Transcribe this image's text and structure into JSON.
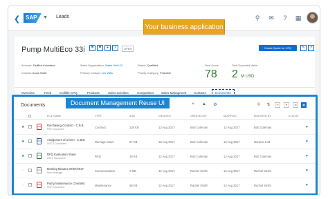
{
  "shell": {
    "back_icon": "back-icon",
    "logo_text": "SAP",
    "title": "Leads",
    "icons": [
      "search-icon",
      "bell-icon",
      "help-icon",
      "grid-icon"
    ]
  },
  "callouts": {
    "business_app": "Your business application",
    "reuse_ui": "Document Management Reuse UI"
  },
  "object": {
    "title": "Pump MultiEco 33i",
    "status_badge": "OPEN",
    "create_button": "Create Quote for CPQ",
    "attributes": [
      {
        "label": "Account:",
        "value": "DelBert Industries"
      },
      {
        "label": "Contact:",
        "value": "Anna Smith"
      },
      {
        "label": "Sales Organization:",
        "value": "Sales Unit US"
      },
      {
        "label": "Primary Contact:",
        "value": "Joe Wills"
      },
      {
        "label": "Status:",
        "value": "Qualified"
      },
      {
        "label": "Priority Category:",
        "value": "Probable"
      }
    ],
    "kpis": [
      {
        "label": "Deal Score",
        "value": "78",
        "unit": ""
      },
      {
        "label": "Total Expected Value",
        "value": "2",
        "unit": "M USD"
      }
    ],
    "tabs": [
      "Overview",
      "Feed",
      "Collible CPQ",
      "Products",
      "Sales activities",
      "Competitors",
      "Sales Managment",
      "Contacts",
      "Documents"
    ],
    "active_tab": "Documents"
  },
  "documents": {
    "title": "Documents",
    "columns": [
      "FILE NAME",
      "TYPE",
      "SIZE",
      "CREATED",
      "CREATED BY",
      "MODIFIED",
      "MODIFIED BY",
      "STATUS"
    ],
    "rows": [
      {
        "starred": true,
        "icon": "pdf-file-icon",
        "icon_text": "PDF",
        "name": "Purchasing Contract - C.B.B.",
        "sub": "PDF Document",
        "type": "Contract",
        "size": "135 KB",
        "created": "12 Aug 2017",
        "created_by": "Bob Coleman",
        "modified": "12 Aug 2017",
        "modified_by": "Bob Coleman"
      },
      {
        "starred": true,
        "icon": "word-file-icon",
        "icon_text": "DOC",
        "name": "Assignment of a form - C.B.B.",
        "sub": "DOCX Document",
        "type": "Damage Claim",
        "size": "27 KB",
        "created": "18 Aug 2017",
        "created_by": "Bob Coleman",
        "modified": "19 Aug 2017",
        "modified_by": "Norman Lott"
      },
      {
        "starred": true,
        "icon": "excel-file-icon",
        "icon_text": "XLS",
        "name": "RFQ Evaluation Sheet",
        "sub": "XSLX Document",
        "type": "RFQ",
        "size": "18 KB",
        "created": "12 Aug 2017",
        "created_by": "Bob Coleman",
        "modified": "12 Aug 2017",
        "modified_by": "Bob Coleman"
      },
      {
        "starred": false,
        "icon": "mail-file-icon",
        "icon_text": "MSG",
        "name": "Meeting Minutes 27/07/2017",
        "sub": "Mail Message",
        "type": "Communication",
        "size": "2 MB",
        "created": "12 Aug 2017",
        "created_by": "Rachel Smith",
        "modified": "12 Aug 2017",
        "modified_by": "Rachel Smith"
      },
      {
        "starred": false,
        "icon": "pdf-file-icon",
        "icon_text": "PDF",
        "name": "Pump Maintenance Checklist",
        "sub": "PDF Document",
        "type": "Maintenance",
        "size": "58 KB",
        "created": "12 Aug 2017",
        "created_by": "Rachel Smith",
        "modified": "12 Aug 2017",
        "modified_by": "Rachel Smith"
      }
    ]
  }
}
